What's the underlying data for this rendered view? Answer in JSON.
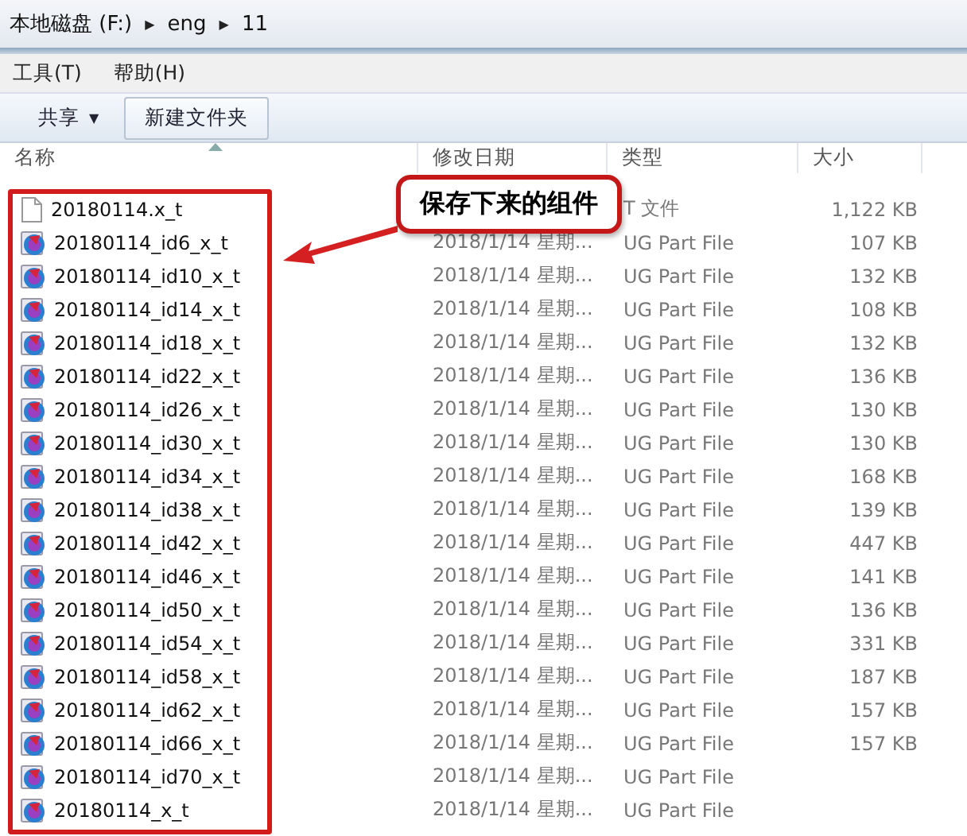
{
  "address_bar": {
    "path": [
      "本地磁盘 (F:)",
      "eng",
      "11"
    ],
    "separator": "▶"
  },
  "menu": [
    "工具(T)",
    "帮助(H)"
  ],
  "toolbar": [
    {
      "kind": "dropdown",
      "label": "共享",
      "caret": "▼"
    },
    {
      "kind": "button",
      "label": "新建文件夹"
    }
  ],
  "columns": [
    {
      "label": "名称",
      "sorted": true
    },
    {
      "label": "修改日期",
      "sorted": false
    },
    {
      "label": "类型",
      "sorted": false
    },
    {
      "label": "大小",
      "sorted": false
    }
  ],
  "annotation": {
    "text": "保存下来的组件"
  },
  "files": [
    {
      "kind": "text",
      "name": "20180114.x_t",
      "type": "T 文件",
      "size": "1,122 KB"
    },
    {
      "kind": "part",
      "name": "20180114_id6_x_t",
      "date": "2018/1/14 星期...",
      "type": "UG Part File",
      "size": "107 KB"
    },
    {
      "kind": "part",
      "name": "20180114_id10_x_t",
      "date": "2018/1/14 星期...",
      "type": "UG Part File",
      "size": "132 KB"
    },
    {
      "kind": "part",
      "name": "20180114_id14_x_t",
      "date": "2018/1/14 星期...",
      "type": "UG Part File",
      "size": "108 KB"
    },
    {
      "kind": "part",
      "name": "20180114_id18_x_t",
      "date": "2018/1/14 星期...",
      "type": "UG Part File",
      "size": "132 KB"
    },
    {
      "kind": "part",
      "name": "20180114_id22_x_t",
      "date": "2018/1/14 星期...",
      "type": "UG Part File",
      "size": "136 KB"
    },
    {
      "kind": "part",
      "name": "20180114_id26_x_t",
      "date": "2018/1/14 星期...",
      "type": "UG Part File",
      "size": "130 KB"
    },
    {
      "kind": "part",
      "name": "20180114_id30_x_t",
      "date": "2018/1/14 星期...",
      "type": "UG Part File",
      "size": "130 KB"
    },
    {
      "kind": "part",
      "name": "20180114_id34_x_t",
      "date": "2018/1/14 星期...",
      "type": "UG Part File",
      "size": "168 KB"
    },
    {
      "kind": "part",
      "name": "20180114_id38_x_t",
      "date": "2018/1/14 星期...",
      "type": "UG Part File",
      "size": "139 KB"
    },
    {
      "kind": "part",
      "name": "20180114_id42_x_t",
      "date": "2018/1/14 星期...",
      "type": "UG Part File",
      "size": "447 KB"
    },
    {
      "kind": "part",
      "name": "20180114_id46_x_t",
      "date": "2018/1/14 星期...",
      "type": "UG Part File",
      "size": "141 KB"
    },
    {
      "kind": "part",
      "name": "20180114_id50_x_t",
      "date": "2018/1/14 星期...",
      "type": "UG Part File",
      "size": "136 KB"
    },
    {
      "kind": "part",
      "name": "20180114_id54_x_t",
      "date": "2018/1/14 星期...",
      "type": "UG Part File",
      "size": "331 KB"
    },
    {
      "kind": "part",
      "name": "20180114_id58_x_t",
      "date": "2018/1/14 星期...",
      "type": "UG Part File",
      "size": "187 KB"
    },
    {
      "kind": "part",
      "name": "20180114_id62_x_t",
      "date": "2018/1/14 星期...",
      "type": "UG Part File",
      "size": "157 KB"
    },
    {
      "kind": "part",
      "name": "20180114_id66_x_t",
      "date": "2018/1/14 星期...",
      "type": "UG Part File",
      "size": "157 KB"
    },
    {
      "kind": "part",
      "name": "20180114_id70_x_t",
      "date": "2018/1/14 星期...",
      "type": "UG Part File"
    },
    {
      "kind": "part",
      "name": "20180114_x_t",
      "date": "2018/1/14 星期...",
      "type": "UG Part File"
    }
  ]
}
